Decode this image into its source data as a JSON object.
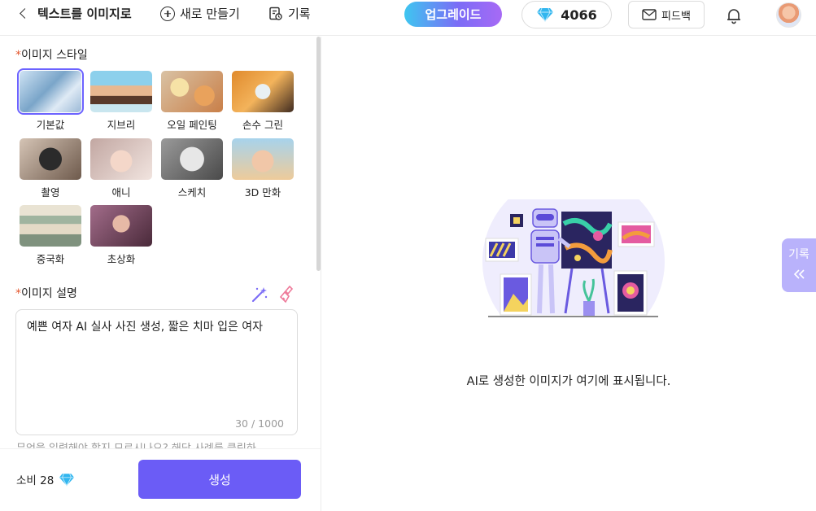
{
  "header": {
    "back_title": "텍스트를 이미지로",
    "new_label": "새로 만들기",
    "history_label": "기록",
    "upgrade_label": "업그레이드",
    "credits": "4066",
    "feedback_label": "피드백"
  },
  "left": {
    "style_section": {
      "required_mark": "*",
      "label": "이미지 스타일"
    },
    "styles": [
      {
        "label": "기본값",
        "selected": true
      },
      {
        "label": "지브리"
      },
      {
        "label": "오일 페인팅"
      },
      {
        "label": "손수 그린"
      },
      {
        "label": "촬영"
      },
      {
        "label": "애니"
      },
      {
        "label": "스케치"
      },
      {
        "label": "3D 만화"
      },
      {
        "label": "중국화"
      },
      {
        "label": "초상화"
      }
    ],
    "desc_section": {
      "required_mark": "*",
      "label": "이미지 설명"
    },
    "description": "예쁜 여자 AI 실사 사진 생성, 짧은 치마 입은 여자",
    "char_count": "30 / 1000",
    "hint": "무엇을 입력해야 할지 모르시나요? 해당 사례를 클릭하",
    "cost_label": "소비 28",
    "generate_label": "생성"
  },
  "main": {
    "empty_message": "AI로 생성한 이미지가 여기에 표시됩니다.",
    "history_tab_label": "기록"
  },
  "colors": {
    "accent": "#6b5cf6",
    "history_tab": "#b9b2fb",
    "required": "#e4572e",
    "diamond": "#2ab7f0"
  },
  "icons": [
    "chevron-left-icon",
    "plus-circle-icon",
    "history-icon",
    "diamond-icon",
    "mail-icon",
    "bell-icon",
    "magic-wand-icon",
    "brush-icon",
    "double-chevron-left-icon"
  ]
}
